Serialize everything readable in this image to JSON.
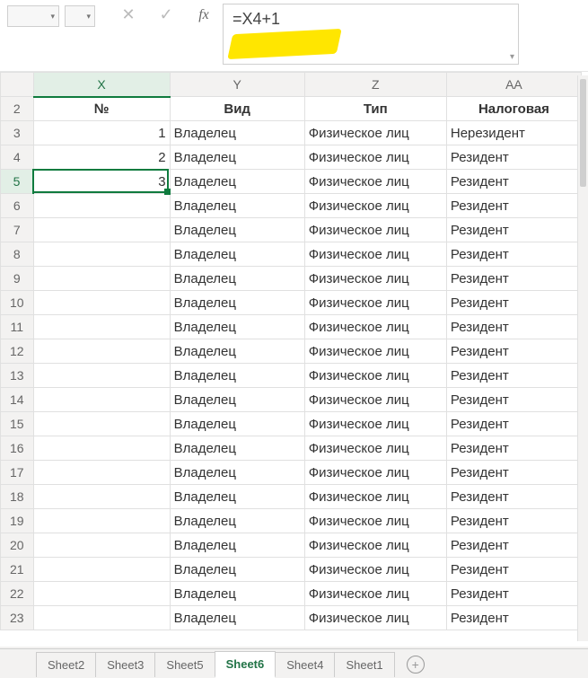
{
  "toolbar": {
    "cancel_icon": "✕",
    "accept_icon": "✓",
    "fx_label": "fx"
  },
  "formula": "=X4+1",
  "columns": [
    "X",
    "Y",
    "Z",
    "AA"
  ],
  "headers": {
    "X": "№",
    "Y": "Вид",
    "Z": "Тип",
    "AA": "Налоговая"
  },
  "rows": [
    {
      "n": 2,
      "X": "",
      "Y": "",
      "Z": "",
      "AA": "",
      "hdr": true
    },
    {
      "n": 3,
      "X": "1",
      "Y": "Владелец",
      "Z": "Физическое лицо",
      "AA": "Нерезидент"
    },
    {
      "n": 4,
      "X": "2",
      "Y": "Владелец",
      "Z": "Физическое лицо",
      "AA": "Резидент"
    },
    {
      "n": 5,
      "X": "3",
      "Y": "Владелец",
      "Z": "Физическое лицо",
      "AA": "Резидент"
    },
    {
      "n": 6,
      "X": "",
      "Y": "Владелец",
      "Z": "Физическое лицо",
      "AA": "Резидент"
    },
    {
      "n": 7,
      "X": "",
      "Y": "Владелец",
      "Z": "Физическое лицо",
      "AA": "Резидент"
    },
    {
      "n": 8,
      "X": "",
      "Y": "Владелец",
      "Z": "Физическое лицо",
      "AA": "Резидент"
    },
    {
      "n": 9,
      "X": "",
      "Y": "Владелец",
      "Z": "Физическое лицо",
      "AA": "Резидент"
    },
    {
      "n": 10,
      "X": "",
      "Y": "Владелец",
      "Z": "Физическое лицо",
      "AA": "Резидент"
    },
    {
      "n": 11,
      "X": "",
      "Y": "Владелец",
      "Z": "Физическое лицо",
      "AA": "Резидент"
    },
    {
      "n": 12,
      "X": "",
      "Y": "Владелец",
      "Z": "Физическое лицо",
      "AA": "Резидент"
    },
    {
      "n": 13,
      "X": "",
      "Y": "Владелец",
      "Z": "Физическое лицо",
      "AA": "Резидент"
    },
    {
      "n": 14,
      "X": "",
      "Y": "Владелец",
      "Z": "Физическое лицо",
      "AA": "Резидент"
    },
    {
      "n": 15,
      "X": "",
      "Y": "Владелец",
      "Z": "Физическое лицо",
      "AA": "Резидент"
    },
    {
      "n": 16,
      "X": "",
      "Y": "Владелец",
      "Z": "Физическое лицо",
      "AA": "Резидент"
    },
    {
      "n": 17,
      "X": "",
      "Y": "Владелец",
      "Z": "Физическое лицо",
      "AA": "Резидент"
    },
    {
      "n": 18,
      "X": "",
      "Y": "Владелец",
      "Z": "Физическое лицо",
      "AA": "Резидент"
    },
    {
      "n": 19,
      "X": "",
      "Y": "Владелец",
      "Z": "Физическое лицо",
      "AA": "Резидент"
    },
    {
      "n": 20,
      "X": "",
      "Y": "Владелец",
      "Z": "Физическое лицо",
      "AA": "Резидент"
    },
    {
      "n": 21,
      "X": "",
      "Y": "Владелец",
      "Z": "Физическое лицо",
      "AA": "Резидент"
    },
    {
      "n": 22,
      "X": "",
      "Y": "Владелец",
      "Z": "Физическое лицо",
      "AA": "Резидент"
    },
    {
      "n": 23,
      "X": "",
      "Y": "Владелец",
      "Z": "Физическое лицо",
      "AA": "Резидент"
    }
  ],
  "selection": {
    "row": 5,
    "col": "X"
  },
  "tabs": [
    "Sheet2",
    "Sheet3",
    "Sheet5",
    "Sheet6",
    "Sheet4",
    "Sheet1"
  ],
  "active_tab": "Sheet6"
}
